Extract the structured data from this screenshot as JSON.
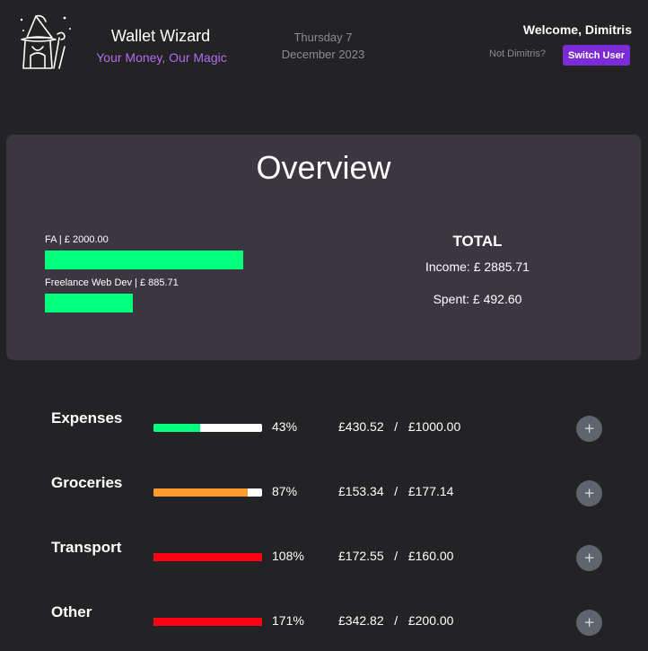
{
  "header": {
    "app_name": "Wallet Wizard",
    "tagline": "Your Money, Our Magic",
    "date_line1": "Thursday 7",
    "date_line2": "December 2023",
    "welcome": "Welcome, Dimitris",
    "not_user": "Not Dimitris?",
    "switch_label": "Switch User",
    "logo_icon": "wizard-icon",
    "accent_color": "#7c2cd6",
    "tagline_color": "#b36bf0"
  },
  "overview": {
    "title": "Overview",
    "income_sources": [
      {
        "label": "FA  |  £ 2000.00",
        "share_of_max": 1.0
      },
      {
        "label": "Freelance Web Dev  |  £ 885.71",
        "share_of_max": 0.4429
      }
    ],
    "bar_color": "#00ff7b",
    "total_title": "TOTAL",
    "income_line": "Income: £ 2885.71",
    "spent_line": "Spent: £ 492.60"
  },
  "budgets": [
    {
      "name": "Expenses",
      "percent_label": "43%",
      "fill_fraction": 0.43,
      "color": "#00ff7b",
      "spent": "£430.52",
      "separator": "/",
      "limit": "£1000.00",
      "add_icon": "plus-icon"
    },
    {
      "name": "Groceries",
      "percent_label": "87%",
      "fill_fraction": 0.87,
      "color": "#ff9a2e",
      "spent": "£153.34",
      "separator": "/",
      "limit": "£177.14",
      "add_icon": "plus-icon"
    },
    {
      "name": "Transport",
      "percent_label": "108%",
      "fill_fraction": 1.0,
      "color": "#ff0013",
      "spent": "£172.55",
      "separator": "/",
      "limit": "£160.00",
      "add_icon": "plus-icon"
    },
    {
      "name": "Other",
      "percent_label": "171%",
      "fill_fraction": 1.0,
      "color": "#ff0013",
      "spent": "£342.82",
      "separator": "/",
      "limit": "£200.00",
      "add_icon": "plus-icon"
    }
  ],
  "add_symbol": "+"
}
